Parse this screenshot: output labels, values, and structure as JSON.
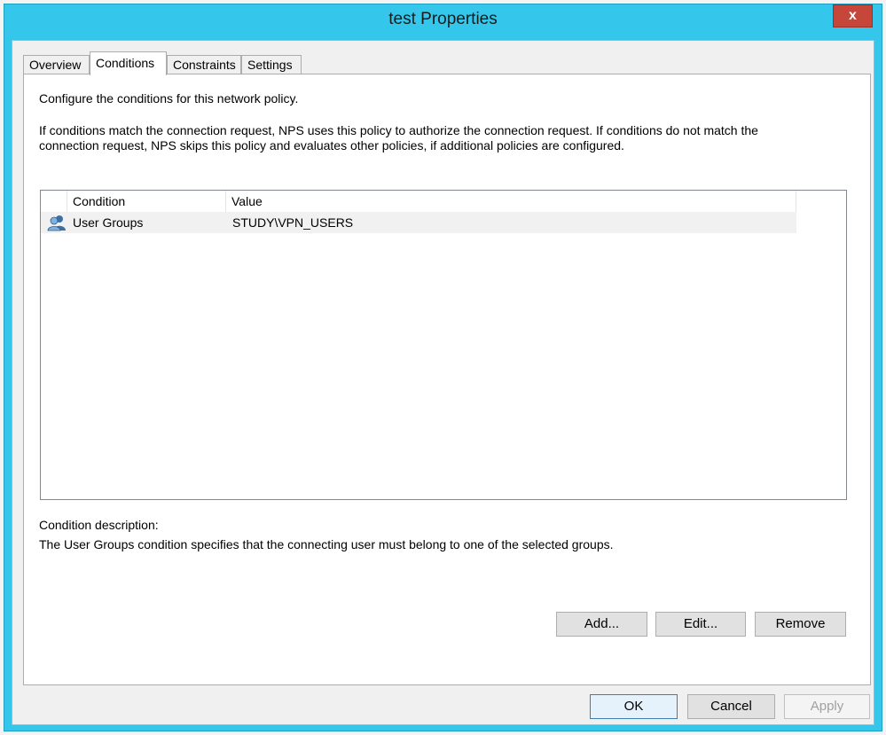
{
  "window": {
    "title": "test Properties",
    "close_label": "x"
  },
  "tabs": [
    {
      "label": "Overview",
      "active": false
    },
    {
      "label": "Conditions",
      "active": true
    },
    {
      "label": "Constraints",
      "active": false
    },
    {
      "label": "Settings",
      "active": false
    }
  ],
  "conditions": {
    "intro": "Configure the conditions for this network policy.",
    "explanation_line1": "If conditions match the connection request, NPS uses this policy to authorize the connection request. If conditions do not match the",
    "explanation_line2": "connection request, NPS skips this policy and evaluates other policies, if additional policies are configured.",
    "list": {
      "columns": [
        "Condition",
        "Value"
      ],
      "rows": [
        {
          "icon": "user-groups-icon",
          "condition": "User Groups",
          "value": "STUDY\\VPN_USERS"
        }
      ]
    },
    "description_label": "Condition description:",
    "description_text": "The User Groups condition specifies that the connecting user must belong to one of the selected groups.",
    "buttons": {
      "add": "Add...",
      "edit": "Edit...",
      "remove": "Remove"
    }
  },
  "footer": {
    "ok": "OK",
    "cancel": "Cancel",
    "apply": "Apply"
  }
}
